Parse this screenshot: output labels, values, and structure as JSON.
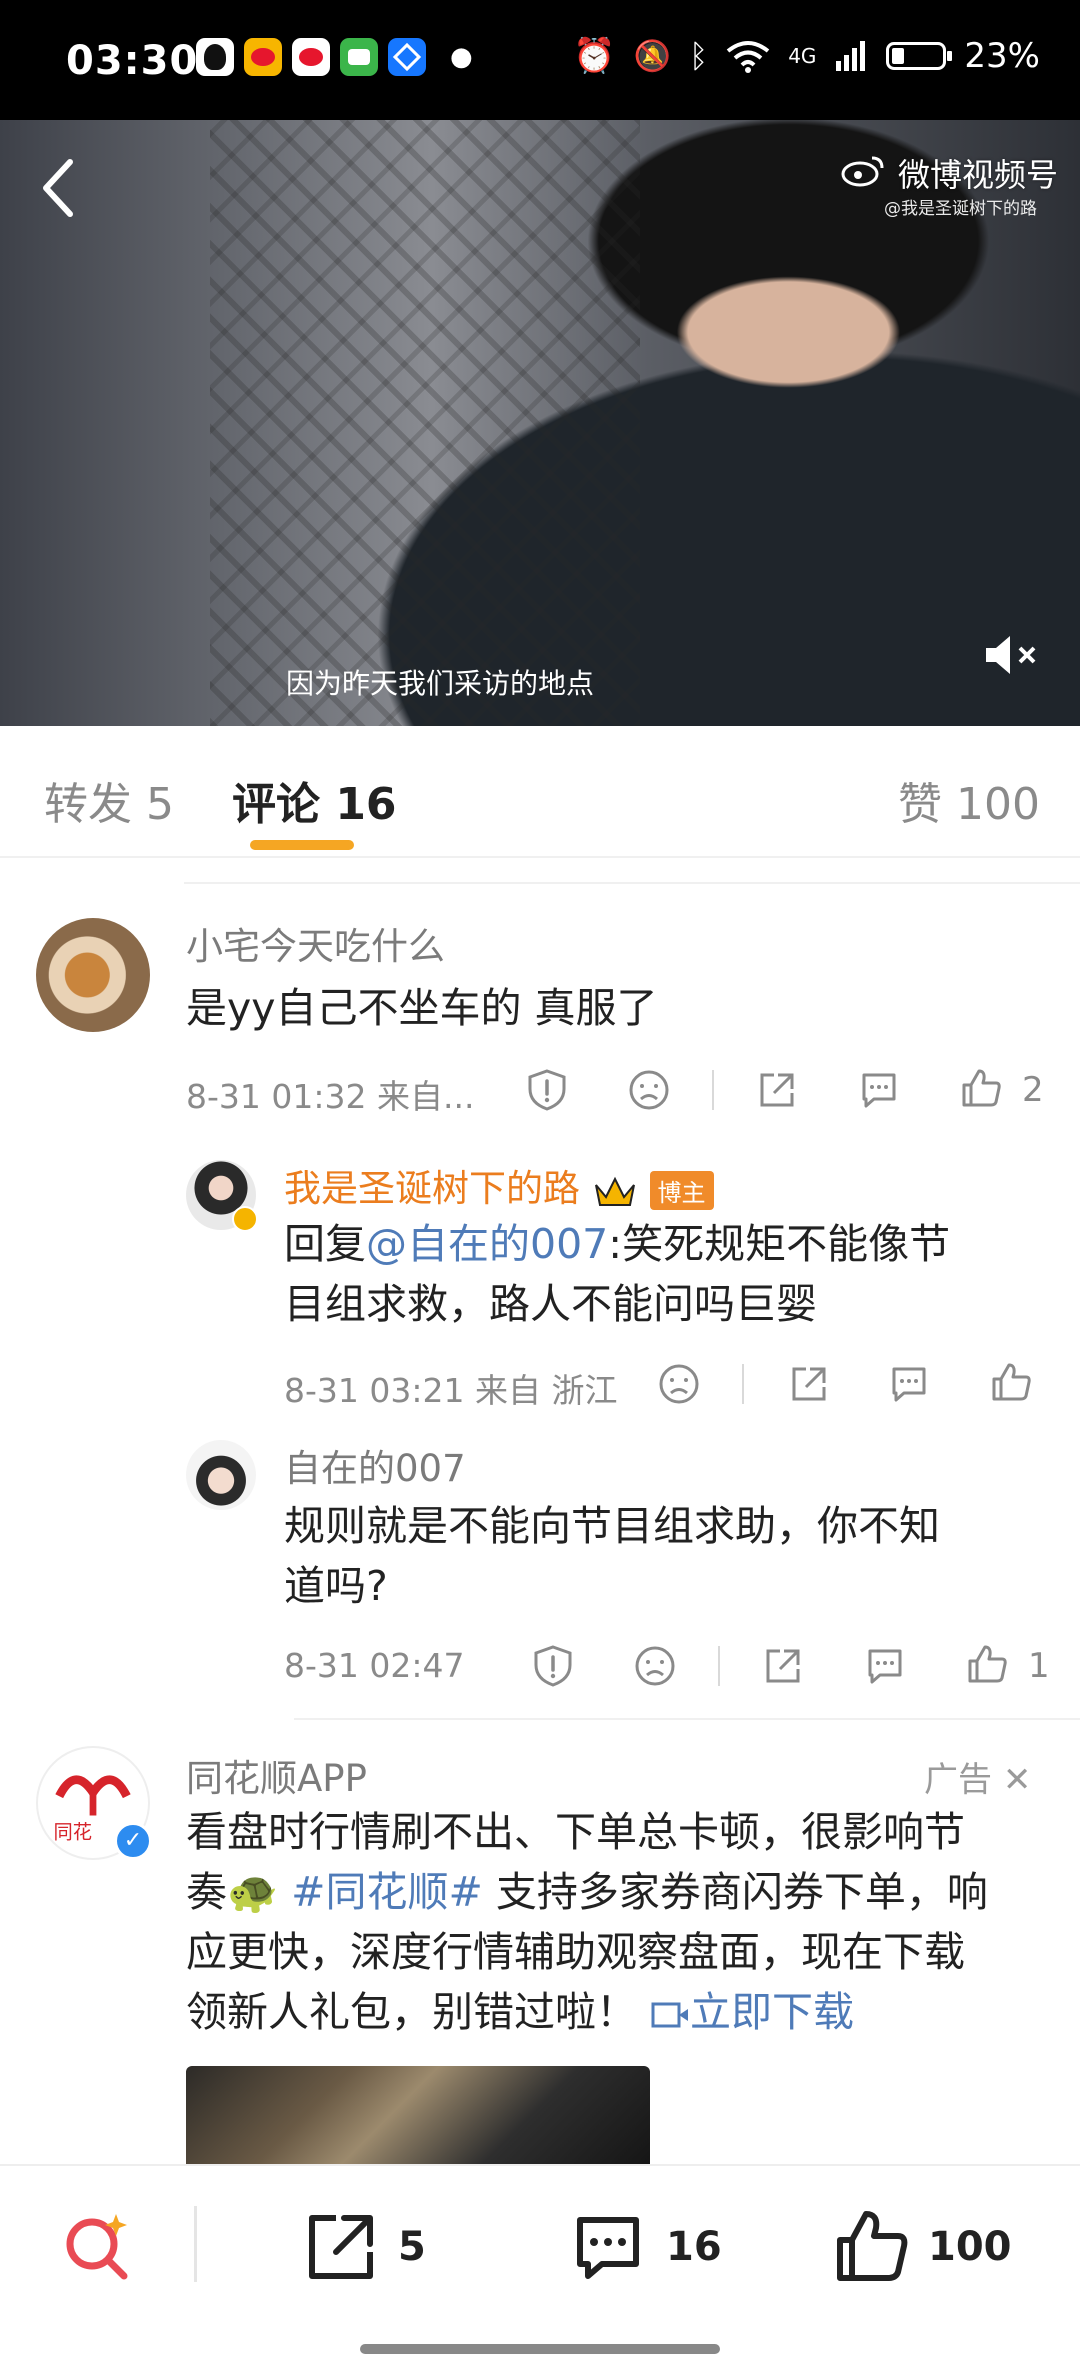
{
  "status_bar": {
    "time": "03:30",
    "network": "4G",
    "battery": "23%"
  },
  "video": {
    "watermark_title": "微博视频号",
    "watermark_user": "@我是圣诞树下的路",
    "subtitle": "因为昨天我们采访的地点"
  },
  "tabs": {
    "repost": "转发 5",
    "comment": "评论 16",
    "like": "赞 100"
  },
  "comments": [
    {
      "user": "小宅今天吃什么",
      "text": "是yy自己不坐车的 真服了",
      "meta": "8-31 01:32  来自...",
      "likes": "2"
    }
  ],
  "replies": [
    {
      "user": "我是圣诞树下的路",
      "badge": "博主",
      "reply_prefix": "回复",
      "mention": "@自在的007",
      "text_line1": ":笑死规矩不能像节",
      "text_line2": "目组求救，路人不能问吗巨婴",
      "meta": "8-31 03:21  来自 浙江",
      "likes": ""
    },
    {
      "user": "自在的007",
      "text_line1": "规则就是不能向节目组求助，你不知",
      "text_line2": "道吗?",
      "meta": "8-31 02:47",
      "likes": "1"
    }
  ],
  "ad": {
    "user": "同花顺APP",
    "label": "广告",
    "avatar_text": "同花",
    "line1": "看盘时行情刷不出、下单总卡顿，很影响节",
    "line2_a": "奏🐢 ",
    "hashtag": "#同花顺#",
    "line2_b": " 支持多家券商闪券下单，响",
    "line3": "应更快，深度行情辅助观察盘面，现在下载",
    "line4": "领新人礼包，别错过啦！",
    "link": "立即下载"
  },
  "bottom_bar": {
    "repost_count": "5",
    "comment_count": "16",
    "like_count": "100"
  }
}
